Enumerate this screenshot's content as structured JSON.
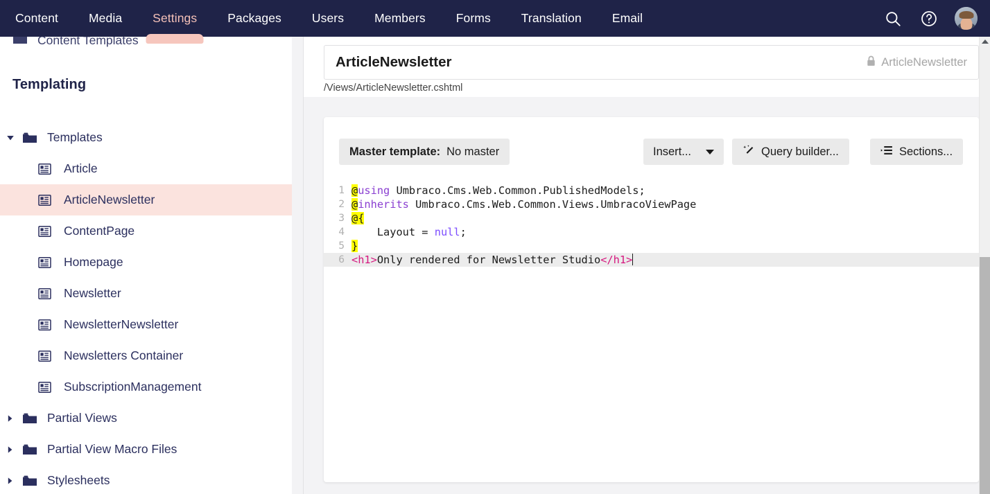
{
  "topnav": {
    "items": [
      {
        "label": "Content",
        "active": false
      },
      {
        "label": "Media",
        "active": false
      },
      {
        "label": "Settings",
        "active": true
      },
      {
        "label": "Packages",
        "active": false
      },
      {
        "label": "Users",
        "active": false
      },
      {
        "label": "Members",
        "active": false
      },
      {
        "label": "Forms",
        "active": false
      },
      {
        "label": "Translation",
        "active": false
      },
      {
        "label": "Email",
        "active": false
      }
    ],
    "search_icon": "search-icon",
    "help_icon": "help-circle-icon",
    "avatar_icon": "user-avatar",
    "bg_color": "#1f2348",
    "active_color": "#f5c1b8"
  },
  "sidebar": {
    "clipped_item": "Content Templates",
    "section_title": "Templating",
    "tree": [
      {
        "label": "Templates",
        "type": "folder",
        "expanded": true,
        "depth": 0,
        "selected": false
      },
      {
        "label": "Article",
        "type": "template",
        "depth": 1,
        "selected": false
      },
      {
        "label": "ArticleNewsletter",
        "type": "template",
        "depth": 1,
        "selected": true
      },
      {
        "label": "ContentPage",
        "type": "template",
        "depth": 1,
        "selected": false
      },
      {
        "label": "Homepage",
        "type": "template",
        "depth": 1,
        "selected": false
      },
      {
        "label": "Newsletter",
        "type": "template",
        "depth": 1,
        "selected": false
      },
      {
        "label": "NewsletterNewsletter",
        "type": "template",
        "depth": 1,
        "selected": false
      },
      {
        "label": "Newsletters Container",
        "type": "template",
        "depth": 1,
        "selected": false
      },
      {
        "label": "SubscriptionManagement",
        "type": "template",
        "depth": 1,
        "selected": false
      },
      {
        "label": "Partial Views",
        "type": "folder",
        "expanded": false,
        "depth": 0,
        "selected": false
      },
      {
        "label": "Partial View Macro Files",
        "type": "folder",
        "expanded": false,
        "depth": 0,
        "selected": false
      },
      {
        "label": "Stylesheets",
        "type": "folder",
        "expanded": false,
        "depth": 0,
        "selected": false
      }
    ],
    "selected_bg": "#fbe3de",
    "text_color": "#2b2f5e"
  },
  "editor": {
    "name": "ArticleNewsletter",
    "alias_locked": "ArticleNewsletter",
    "lock_icon": "lock-icon",
    "file_path": "/Views/ArticleNewsletter.cshtml",
    "toolbar": {
      "master_label": "Master template:",
      "master_value": "No master",
      "insert_label": "Insert...",
      "insert_caret_icon": "chevron-down-icon",
      "query_builder_label": "Query builder...",
      "query_builder_icon": "magic-wand-icon",
      "sections_label": "Sections...",
      "sections_icon": "indent-list-icon"
    },
    "code_lines": [
      {
        "number": "1",
        "active": false,
        "tokens": [
          {
            "t": "@",
            "c": "razor"
          },
          {
            "t": "using",
            "c": "kw"
          },
          {
            "t": " Umbraco.Cms.Web.Common.PublishedModels;",
            "c": "plain"
          }
        ]
      },
      {
        "number": "2",
        "active": false,
        "tokens": [
          {
            "t": "@",
            "c": "razor"
          },
          {
            "t": "inherits",
            "c": "kw"
          },
          {
            "t": " Umbraco.Cms.Web.Common.Views.UmbracoViewPage",
            "c": "plain"
          }
        ]
      },
      {
        "number": "3",
        "active": false,
        "tokens": [
          {
            "t": "@{",
            "c": "razor"
          }
        ]
      },
      {
        "number": "4",
        "active": false,
        "tokens": [
          {
            "t": "    Layout = ",
            "c": "plain"
          },
          {
            "t": "null",
            "c": "null"
          },
          {
            "t": ";",
            "c": "plain"
          }
        ]
      },
      {
        "number": "5",
        "active": false,
        "tokens": [
          {
            "t": "}",
            "c": "razor"
          }
        ]
      },
      {
        "number": "6",
        "active": true,
        "tokens": [
          {
            "t": "<h1>",
            "c": "tag"
          },
          {
            "t": "Only rendered for Newsletter Studio",
            "c": "plain"
          },
          {
            "t": "</h1>",
            "c": "tag"
          }
        ]
      }
    ],
    "colors": {
      "razor_highlight": "#ffff00",
      "keyword": "#8a3fd1",
      "tag": "#d6187f",
      "active_line": "#ececec"
    }
  }
}
